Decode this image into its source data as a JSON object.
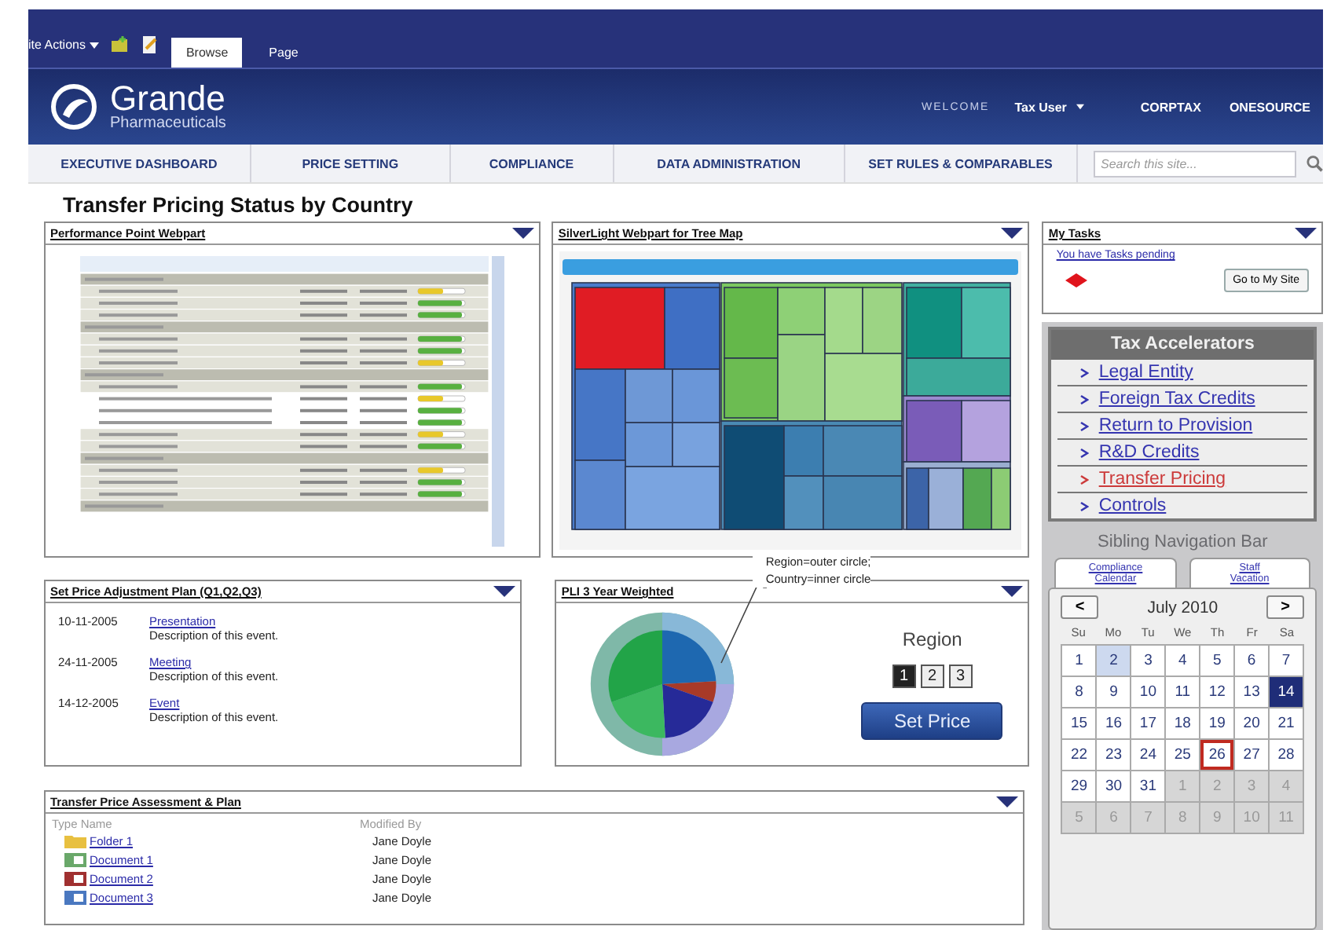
{
  "ribbon": {
    "site_actions": "ite Actions",
    "tabs": [
      {
        "label": "Browse",
        "selected": true
      },
      {
        "label": "Page",
        "selected": false
      }
    ]
  },
  "header": {
    "brand": "Grande",
    "tagline": "Pharmaceuticals",
    "welcome": "WELCOME",
    "user": "Tax User",
    "links": [
      "CORPTAX",
      "ONESOURCE"
    ]
  },
  "nav": {
    "items": [
      "EXECUTIVE DASHBOARD",
      "PRICE SETTING",
      "COMPLIANCE",
      "DATA ADMINISTRATION",
      "SET RULES & COMPARABLES"
    ],
    "search": {
      "placeholder": "Search this site..."
    }
  },
  "page_title": "Transfer Pricing Status by Country",
  "performance_webpart": {
    "title": "Performance Point Webpart"
  },
  "treemap_webpart": {
    "title": "SilverLight Webpart for Tree Map"
  },
  "events_webpart": {
    "title": "Set Price Adjustment Plan (Q1,Q2,Q3)",
    "events": [
      {
        "date": "10-11-2005",
        "title": "Presentation",
        "description": "Description of this event."
      },
      {
        "date": "24-11-2005",
        "title": "Meeting",
        "description": "Description of this event."
      },
      {
        "date": "14-12-2005",
        "title": "Event",
        "description": "Description of this event."
      }
    ]
  },
  "pli_webpart": {
    "title": "PLI 3 Year Weighted",
    "callout": [
      "Region=outer circle;",
      "Country=inner circle"
    ],
    "legend_title": "Region",
    "pages": [
      {
        "label": "1",
        "selected": true
      },
      {
        "label": "2",
        "selected": false
      },
      {
        "label": "3",
        "selected": false
      }
    ],
    "button": "Set Price"
  },
  "documents_webpart": {
    "title": "Transfer Price Assessment & Plan",
    "columns": [
      "Type Name",
      "Modified By"
    ],
    "rows": [
      {
        "kind": "folder",
        "name": "Folder 1",
        "modified_by": "Jane Doyle",
        "color": "#e8c040"
      },
      {
        "kind": "document",
        "name": "Document 1",
        "modified_by": "Jane Doyle",
        "color": "#6aa86a"
      },
      {
        "kind": "document",
        "name": "Document 2",
        "modified_by": "Jane Doyle",
        "color": "#a03030"
      },
      {
        "kind": "document",
        "name": "Document 3",
        "modified_by": "Jane Doyle",
        "color": "#4a78c0"
      }
    ]
  },
  "my_tasks": {
    "title": "My Tasks",
    "message": "You have Tasks pending",
    "button": "Go to My Site"
  },
  "tax_accelerators": {
    "title": "Tax Accelerators",
    "items": [
      {
        "label": "Legal Entity",
        "selected": false
      },
      {
        "label": "Foreign Tax Credits",
        "selected": false
      },
      {
        "label": "Return to Provision",
        "selected": false
      },
      {
        "label": "R&D Credits",
        "selected": false
      },
      {
        "label": "Transfer Pricing",
        "selected": true
      },
      {
        "label": "Controls",
        "selected": false
      }
    ]
  },
  "sibling_nav": {
    "title": "Sibling Navigation Bar",
    "tabs": [
      [
        "Compliance",
        "Calendar"
      ],
      [
        "Staff",
        "Vacation"
      ]
    ]
  },
  "calendar": {
    "month": "July 2010",
    "prev": "<",
    "next": ">",
    "weekdays": [
      "Su",
      "Mo",
      "Tu",
      "We",
      "Th",
      "Fr",
      "Sa"
    ],
    "weeks": [
      [
        {
          "day": "1",
          "kind": "day"
        },
        {
          "day": "2",
          "kind": "hovered"
        },
        {
          "day": "3",
          "kind": "day"
        },
        {
          "day": "4",
          "kind": "day"
        },
        {
          "day": "5",
          "kind": "day"
        },
        {
          "day": "6",
          "kind": "day"
        },
        {
          "day": "7",
          "kind": "day"
        }
      ],
      [
        {
          "day": "8",
          "kind": "day"
        },
        {
          "day": "9",
          "kind": "day"
        },
        {
          "day": "10",
          "kind": "day"
        },
        {
          "day": "11",
          "kind": "day"
        },
        {
          "day": "12",
          "kind": "day"
        },
        {
          "day": "13",
          "kind": "day"
        },
        {
          "day": "14",
          "kind": "selected"
        }
      ],
      [
        {
          "day": "15",
          "kind": "day"
        },
        {
          "day": "16",
          "kind": "day"
        },
        {
          "day": "17",
          "kind": "day"
        },
        {
          "day": "18",
          "kind": "day"
        },
        {
          "day": "19",
          "kind": "day"
        },
        {
          "day": "20",
          "kind": "day"
        },
        {
          "day": "21",
          "kind": "day"
        }
      ],
      [
        {
          "day": "22",
          "kind": "day"
        },
        {
          "day": "23",
          "kind": "day"
        },
        {
          "day": "24",
          "kind": "day"
        },
        {
          "day": "25",
          "kind": "day"
        },
        {
          "day": "26",
          "kind": "today"
        },
        {
          "day": "27",
          "kind": "day"
        },
        {
          "day": "28",
          "kind": "day"
        }
      ],
      [
        {
          "day": "29",
          "kind": "day"
        },
        {
          "day": "30",
          "kind": "day"
        },
        {
          "day": "31",
          "kind": "day"
        },
        {
          "day": "1",
          "kind": "outside"
        },
        {
          "day": "2",
          "kind": "outside"
        },
        {
          "day": "3",
          "kind": "outside"
        },
        {
          "day": "4",
          "kind": "outside"
        }
      ],
      [
        {
          "day": "5",
          "kind": "outside"
        },
        {
          "day": "6",
          "kind": "outside"
        },
        {
          "day": "7",
          "kind": "outside"
        },
        {
          "day": "8",
          "kind": "outside"
        },
        {
          "day": "9",
          "kind": "outside"
        },
        {
          "day": "10",
          "kind": "outside"
        },
        {
          "day": "11",
          "kind": "outside"
        }
      ]
    ]
  }
}
